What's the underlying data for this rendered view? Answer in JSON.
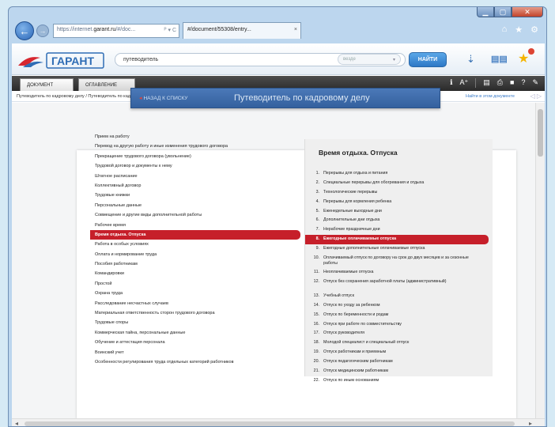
{
  "browser": {
    "address_prefix": "https://internet.",
    "address_domain": "garant.ru",
    "address_suffix": "/#/doc...",
    "address_tools": "ᴾ ▾ C",
    "tab_title": "#/document/55308/entry...",
    "tab_close": "×",
    "window_min": "▁",
    "window_max": "▢",
    "window_close": "✕"
  },
  "app": {
    "logo_text": "ГАРАНТ",
    "search_value": "путеводитель",
    "search_scope_placeholder": "везде",
    "search_button": "НАЙТИ"
  },
  "doc_tabs": {
    "document": "ДОКУМЕНТ",
    "contents": "ОГЛАВЛЕНИЕ"
  },
  "breadcrumb": {
    "text": "Путеводитель по кадровому делу / Путеводитель по кадровому делу (Время отдыха, Отпуска)",
    "link": "Найти в этом документе",
    "controls": "◁ ▷"
  },
  "guide": {
    "back_label": "НАЗАД К СПИСКУ",
    "title": "Путеводитель по кадровому делу"
  },
  "topics": [
    "Прием на работу",
    "Перевод на другую работу и иные изменения трудового договора",
    "Прекращение трудового договора (увольнение)",
    "Трудовой договор и документы к нему",
    "Штатное расписание",
    "Коллективный договор",
    "Трудовые книжки",
    "Персональные данные",
    "Совмещение и другие виды дополнительной работы",
    "Рабочее время",
    "Время отдыха. Отпуска",
    "Работа в особых условиях",
    "Оплата и нормирование труда",
    "Пособия работникам",
    "Командировки",
    "Простой",
    "Охрана труда",
    "Расследование несчастных случаев",
    "Материальная ответственность сторон трудового договора",
    "Трудовые споры",
    "Коммерческая тайна, персональные данные",
    "Обучение и аттестация персонала",
    "Воинский учет",
    "Особенности регулирования труда отдельных категорий работников"
  ],
  "active_topic_index": 10,
  "panel": {
    "title": "Время отдыха. Отпуска",
    "items": [
      {
        "num": "1.",
        "text": "Перерывы для отдыха и питания"
      },
      {
        "num": "2.",
        "text": "Специальные перерывы для обогревания и отдыха"
      },
      {
        "num": "3.",
        "text": "Технологические перерывы"
      },
      {
        "num": "4.",
        "text": "Перерывы для кормления ребенка"
      },
      {
        "num": "5.",
        "text": "Еженедельные выходные дни"
      },
      {
        "num": "6.",
        "text": "Дополнительные дни отдыха"
      },
      {
        "num": "7.",
        "text": "Нерабочие праздничные дни"
      },
      {
        "num": "8.",
        "text": "Ежегодные оплачиваемые отпуска"
      },
      {
        "num": "9.",
        "text": "Ежегодные дополнительные оплачиваемые отпуска"
      },
      {
        "num": "10.",
        "text": "Оплачиваемый отпуск по договору на срок до двух месяцев и за сезонные работы"
      },
      {
        "num": "11.",
        "text": "Неоплачиваемые отпуска"
      },
      {
        "num": "12.",
        "text": "Отпуск без сохранения заработной платы (административный)"
      },
      {
        "num": "13.",
        "text": "Учебный отпуск"
      },
      {
        "num": "14.",
        "text": "Отпуск по уходу за ребенком"
      },
      {
        "num": "15.",
        "text": "Отпуск по беременности и родам"
      },
      {
        "num": "16.",
        "text": "Отпуск при работе по совместительству"
      },
      {
        "num": "17.",
        "text": "Отпуск руководителя"
      },
      {
        "num": "18.",
        "text": "Молодой специалист и специальный отпуск"
      },
      {
        "num": "19.",
        "text": "Отпуск работникам и приемным"
      },
      {
        "num": "20.",
        "text": "Отпуск педагогическим работникам"
      },
      {
        "num": "21.",
        "text": "Отпуск медицинским работникам"
      },
      {
        "num": "22.",
        "text": "Отпуск по иным основаниям"
      }
    ]
  },
  "active_item_index": 7,
  "colors": {
    "accent_red": "#c61f2a",
    "banner_blue": "#3f6cab"
  }
}
